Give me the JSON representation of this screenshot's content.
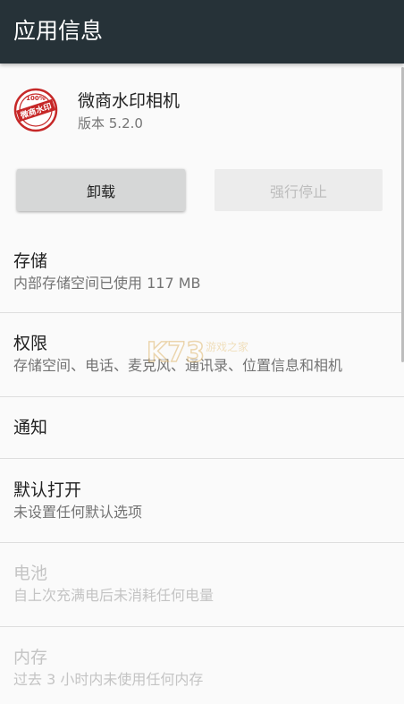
{
  "header": {
    "title": "应用信息"
  },
  "app": {
    "icon": "app-seal-icon",
    "icon_text_top": "100%",
    "icon_text_main": "微商水印",
    "name": "微商水印相机",
    "version": "版本 5.2.0",
    "icon_color": "#c62828"
  },
  "buttons": {
    "uninstall": "卸载",
    "force_stop": "强行停止"
  },
  "rows": [
    {
      "key": "storage",
      "title": "存储",
      "subtitle": "内部存储空间已使用 117 MB",
      "disabled": false
    },
    {
      "key": "permissions",
      "title": "权限",
      "subtitle": "存储空间、电话、麦克风、通讯录、位置信息和相机",
      "disabled": false
    },
    {
      "key": "notifications",
      "title": "通知",
      "subtitle": "",
      "disabled": false
    },
    {
      "key": "open-by-default",
      "title": "默认打开",
      "subtitle": "未设置任何默认选项",
      "disabled": false
    },
    {
      "key": "battery",
      "title": "电池",
      "subtitle": "自上次充满电后未消耗任何电量",
      "disabled": true
    },
    {
      "key": "memory",
      "title": "内存",
      "subtitle": "过去 3 小时内未使用任何内存",
      "disabled": true
    }
  ],
  "watermark": {
    "logo": "K73",
    "text": "游戏之家"
  },
  "colors": {
    "appbar": "#263238",
    "background": "#fafafa",
    "disabled_text": "#c4c4c4"
  }
}
